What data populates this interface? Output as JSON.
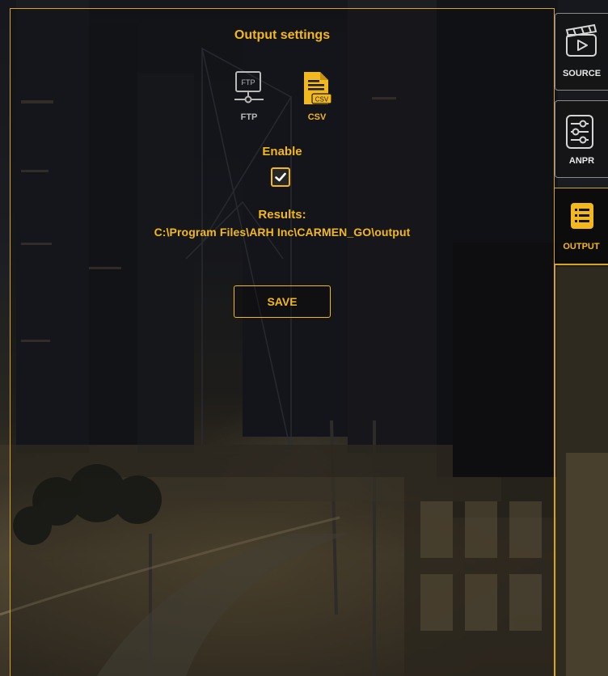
{
  "panel": {
    "title": "Output settings"
  },
  "output_types": {
    "ftp": {
      "label": "FTP",
      "icon": "ftp-icon",
      "icon_text": "FTP",
      "selected": false
    },
    "csv": {
      "label": "CSV",
      "icon": "csv-file-icon",
      "icon_text": "CSV",
      "selected": true
    }
  },
  "enable": {
    "label": "Enable",
    "checked": true
  },
  "results": {
    "label": "Results:",
    "path": "C:\\Program Files\\ARH Inc\\CARMEN_GO\\output"
  },
  "save_button": {
    "label": "SAVE"
  },
  "sidebar": {
    "tabs": [
      {
        "id": "source",
        "label": "SOURCE",
        "icon": "video-clapper-icon",
        "active": false
      },
      {
        "id": "anpr",
        "label": "ANPR",
        "icon": "sliders-icon",
        "active": false
      },
      {
        "id": "output",
        "label": "OUTPUT",
        "icon": "list-icon",
        "active": true
      }
    ]
  },
  "colors": {
    "accent": "#f3b81c",
    "border_accent": "#d9a31a",
    "inactive_text": "#b9b9b9",
    "tab_border": "#8a8a8a"
  }
}
